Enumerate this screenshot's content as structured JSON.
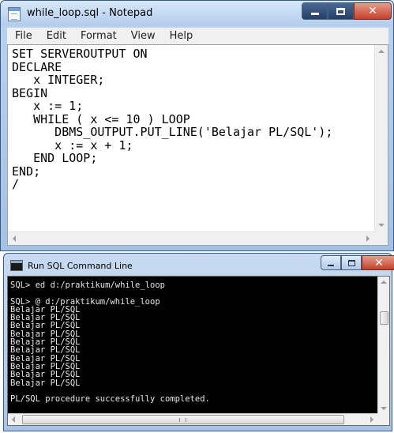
{
  "notepad": {
    "title": "while_loop.sql - Notepad",
    "menu": [
      "File",
      "Edit",
      "Format",
      "View",
      "Help"
    ],
    "content": "SET SERVEROUTPUT ON\nDECLARE\n   x INTEGER;\nBEGIN\n   x := 1;\n   WHILE ( x <= 10 ) LOOP\n      DBMS_OUTPUT.PUT_LINE('Belajar PL/SQL');\n      x := x + 1;\n   END LOOP;\nEND;\n/",
    "icons": {
      "app": "notepad-icon",
      "minimize": "minimize-icon",
      "maximize": "maximize-icon",
      "close": "close-icon"
    }
  },
  "sql_window": {
    "title": "Run SQL Command Line",
    "output": "SQL> ed d:/praktikum/while_loop\n\nSQL> @ d:/praktikum/while_loop\nBelajar PL/SQL\nBelajar PL/SQL\nBelajar PL/SQL\nBelajar PL/SQL\nBelajar PL/SQL\nBelajar PL/SQL\nBelajar PL/SQL\nBelajar PL/SQL\nBelajar PL/SQL\nBelajar PL/SQL\n\nPL/SQL procedure successfully completed.",
    "colors": {
      "background": "#000000",
      "text": "#e8e8e8"
    }
  }
}
